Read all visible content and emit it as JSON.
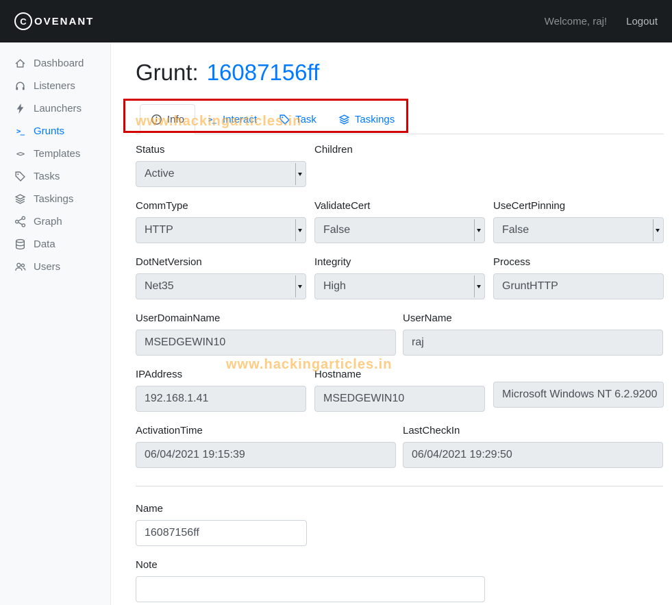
{
  "navbar": {
    "logo_letter": "C",
    "brand": "OVENANT",
    "welcome": "Welcome, raj!",
    "logout": "Logout"
  },
  "sidebar": {
    "items": [
      {
        "label": "Dashboard",
        "icon": "home-icon",
        "active": false
      },
      {
        "label": "Listeners",
        "icon": "headphones-icon",
        "active": false
      },
      {
        "label": "Launchers",
        "icon": "flash-icon",
        "active": false
      },
      {
        "label": "Grunts",
        "icon": "terminal-icon",
        "active": true
      },
      {
        "label": "Templates",
        "icon": "code-icon",
        "active": false
      },
      {
        "label": "Tasks",
        "icon": "tag-icon",
        "active": false
      },
      {
        "label": "Taskings",
        "icon": "layers-icon",
        "active": false
      },
      {
        "label": "Graph",
        "icon": "share-icon",
        "active": false
      },
      {
        "label": "Data",
        "icon": "database-icon",
        "active": false
      },
      {
        "label": "Users",
        "icon": "users-icon",
        "active": false
      }
    ]
  },
  "main": {
    "title_prefix": "Grunt:",
    "grunt_id": "16087156ff",
    "tabs": [
      {
        "label": "Info",
        "icon": "info-icon",
        "active": true
      },
      {
        "label": "Interact",
        "icon": "terminal-icon",
        "active": false
      },
      {
        "label": "Task",
        "icon": "tag-icon",
        "active": false
      },
      {
        "label": "Taskings",
        "icon": "layers-icon",
        "active": false
      }
    ],
    "watermark": "www.hackingarticles.in",
    "form": {
      "status": {
        "label": "Status",
        "value": "Active",
        "control": "select"
      },
      "children": {
        "label": "Children",
        "value": "",
        "control": "none"
      },
      "commtype": {
        "label": "CommType",
        "value": "HTTP",
        "control": "select"
      },
      "validatecert": {
        "label": "ValidateCert",
        "value": "False",
        "control": "select"
      },
      "usecertpinning": {
        "label": "UseCertPinning",
        "value": "False",
        "control": "select"
      },
      "dotnetversion": {
        "label": "DotNetVersion",
        "value": "Net35",
        "control": "select"
      },
      "integrity": {
        "label": "Integrity",
        "value": "High",
        "control": "select"
      },
      "process": {
        "label": "Process",
        "value": "GruntHTTP",
        "control": "readonly"
      },
      "userdomainname": {
        "label": "UserDomainName",
        "value": "MSEDGEWIN10",
        "control": "readonly"
      },
      "username": {
        "label": "UserName",
        "value": "raj",
        "control": "readonly"
      },
      "ipaddress": {
        "label": "IPAddress",
        "value": "192.168.1.41",
        "control": "readonly"
      },
      "hostname": {
        "label": "Hostname",
        "value": "MSEDGEWIN10",
        "control": "readonly"
      },
      "operatingsystem": {
        "label": "",
        "value": "Microsoft Windows NT 6.2.9200",
        "control": "readonly"
      },
      "activationtime": {
        "label": "ActivationTime",
        "value": "06/04/2021 19:15:39",
        "control": "readonly"
      },
      "lastcheckin": {
        "label": "LastCheckIn",
        "value": "06/04/2021 19:29:50",
        "control": "readonly"
      },
      "name": {
        "label": "Name",
        "value": "16087156ff",
        "control": "text"
      },
      "note": {
        "label": "Note",
        "value": "",
        "control": "text"
      }
    }
  },
  "colors": {
    "accent": "#007bff",
    "navbar_bg": "#1a1d20",
    "sidebar_bg": "#f8f9fa",
    "field_bg": "#e9ecef",
    "field_border": "#ced4da",
    "annotation_red": "#d40000",
    "watermark_orange": "#ffa321"
  }
}
